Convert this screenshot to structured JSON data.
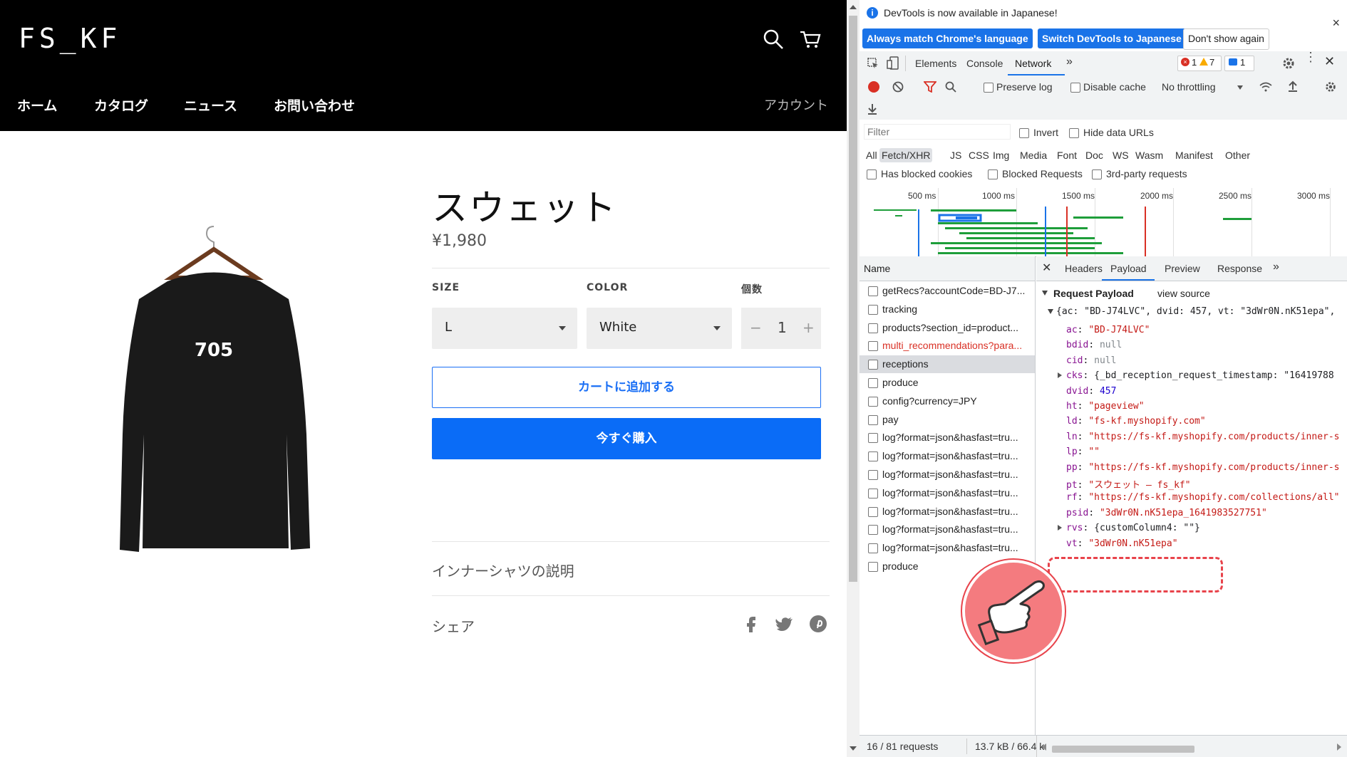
{
  "shop": {
    "logo": "FS_KF",
    "nav": [
      "ホーム",
      "カタログ",
      "ニュース",
      "お問い合わせ"
    ],
    "account": "アカウント",
    "product": {
      "title": "スウェット",
      "price": "¥1,980",
      "shirt_print": "705",
      "size_label": "SIZE",
      "size_value": "L",
      "color_label": "COLOR",
      "color_value": "White",
      "qty_label": "個数",
      "qty_value": "1",
      "qty_minus": "−",
      "qty_plus": "+",
      "add_to_cart": "カートに追加する",
      "buy_now": "今すぐ購入",
      "description": "インナーシャツの説明",
      "share": "シェア"
    }
  },
  "devtools": {
    "info_text": "DevTools is now available in Japanese!",
    "btn_always": "Always match Chrome's language",
    "btn_switch": "Switch DevTools to Japanese",
    "btn_dont": "Don't show again",
    "close": "×",
    "tabs": [
      "Elements",
      "Console",
      "Network"
    ],
    "more_tabs": "»",
    "errors": "1",
    "warnings": "7",
    "messages": "1",
    "toolbar": {
      "preserve_log": "Preserve log",
      "disable_cache": "Disable cache",
      "throttling": "No throttling"
    },
    "filter_placeholder": "Filter",
    "invert": "Invert",
    "hide_data_urls": "Hide data URLs",
    "types": [
      "All",
      "Fetch/XHR",
      "JS",
      "CSS",
      "Img",
      "Media",
      "Font",
      "Doc",
      "WS",
      "Wasm",
      "Manifest",
      "Other"
    ],
    "has_blocked_cookies": "Has blocked cookies",
    "blocked_requests": "Blocked Requests",
    "third_party": "3rd-party requests",
    "timeline_labels": [
      "500 ms",
      "1000 ms",
      "1500 ms",
      "2000 ms",
      "2500 ms",
      "3000 ms"
    ],
    "name_header": "Name",
    "requests": [
      "getRecs?accountCode=BD-J7...",
      "tracking",
      "products?section_id=product...",
      "multi_recommendations?para...",
      "receptions",
      "produce",
      "config?currency=JPY",
      "pay",
      "log?format=json&hasfast=tru...",
      "log?format=json&hasfast=tru...",
      "log?format=json&hasfast=tru...",
      "log?format=json&hasfast=tru...",
      "log?format=json&hasfast=tru...",
      "log?format=json&hasfast=tru...",
      "log?format=json&hasfast=tru...",
      "produce"
    ],
    "status_requests": "16 / 81 requests",
    "status_size": "13.7 kB / 66.4 k",
    "detail_tabs": [
      "Headers",
      "Payload",
      "Preview",
      "Response"
    ],
    "payload": {
      "title": "Request Payload",
      "view_source": "view source",
      "summary": "{ac: \"BD-J74LVC\", dvid: 457, vt: \"3dWr0N.nK51epa\",",
      "lines": [
        {
          "k": "ac",
          "v": "\"BD-J74LVC\"",
          "t": "s"
        },
        {
          "k": "bdid",
          "v": "null",
          "t": "nul"
        },
        {
          "k": "cid",
          "v": "null",
          "t": "nul"
        },
        {
          "k": "cks",
          "v": "{_bd_reception_request_timestamp: \"16419788",
          "t": "plain"
        },
        {
          "k": "dvid",
          "v": "457",
          "t": "n"
        },
        {
          "k": "ht",
          "v": "\"pageview\"",
          "t": "s"
        },
        {
          "k": "ld",
          "v": "\"fs-kf.myshopify.com\"",
          "t": "s"
        },
        {
          "k": "ln",
          "v": "\"https://fs-kf.myshopify.com/products/inner-s",
          "t": "s"
        },
        {
          "k": "lp",
          "v": "\"\"",
          "t": "s"
        },
        {
          "k": "pp",
          "v": "\"https://fs-kf.myshopify.com/products/inner-s",
          "t": "s"
        },
        {
          "k": "pt",
          "v": "\"スウェット – fs_kf\"",
          "t": "s"
        },
        {
          "k": "rf",
          "v": "\"https://fs-kf.myshopify.com/collections/all\"",
          "t": "s"
        },
        {
          "k": "psid",
          "v": "\"3dWr0N.nK51epa_1641983527751\"",
          "t": "s"
        },
        {
          "k": "rvs",
          "v": "{customColumn4: \"\"}",
          "t": "plain"
        },
        {
          "k": "vt",
          "v": "\"3dWr0N.nK51epa\"",
          "t": "s"
        }
      ]
    }
  },
  "colors": {
    "accent": "#1a73e8",
    "buy_button": "#0a6cf7",
    "annotation_red": "#e8434b",
    "annotation_fill": "#f47b7f"
  }
}
